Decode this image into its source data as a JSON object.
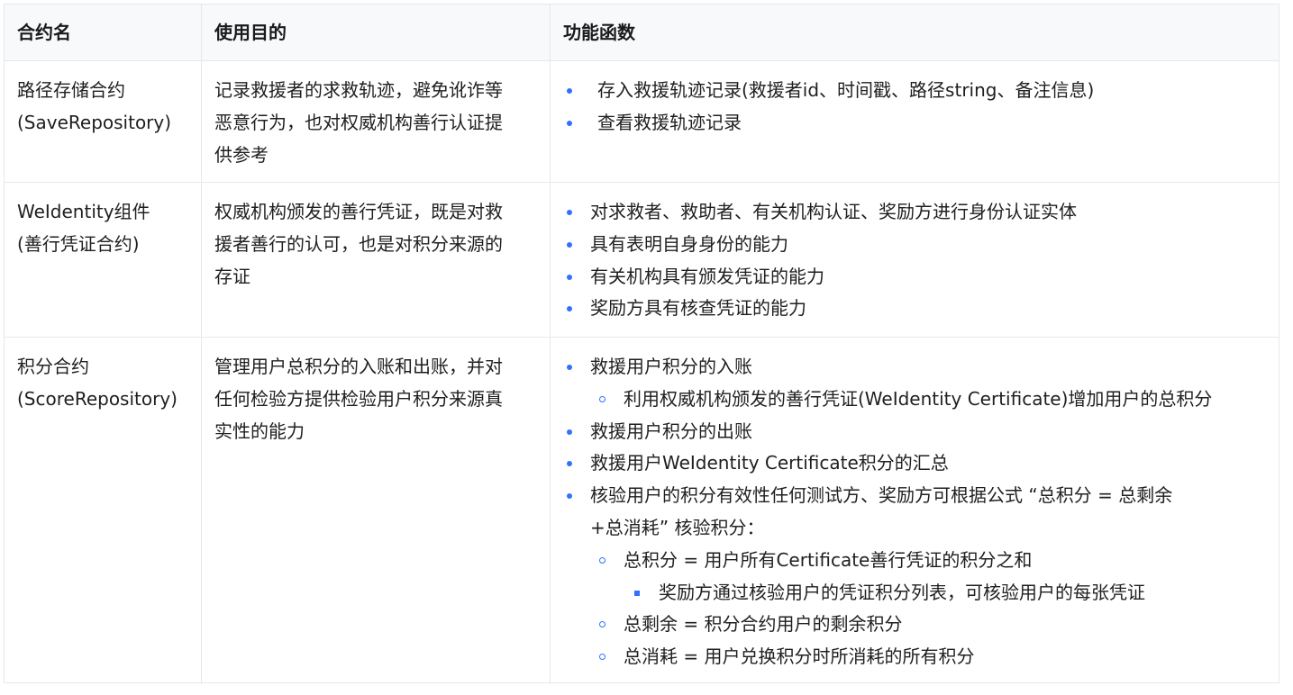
{
  "table": {
    "headers": [
      "合约名",
      "使用目的",
      "功能函数"
    ],
    "rows": [
      {
        "name_lines": [
          "路径存储合约",
          "(SaveRepository)"
        ],
        "purpose_lines": [
          "记录救援者的求救轨迹，避免讹诈等",
          "恶意行为，也对权威机构善行认证提",
          "供参考"
        ],
        "functions": [
          {
            "level": 1,
            "text": "存入救援轨迹记录(救援者id、时间戳、路径string、备注信息)"
          },
          {
            "level": 1,
            "text": "查看救援轨迹记录"
          }
        ]
      },
      {
        "name_lines": [
          "WeIdentity组件",
          "(善行凭证合约)"
        ],
        "purpose_lines": [
          "权威机构颁发的善行凭证，既是对救",
          "援者善行的认可，也是对积分来源的",
          "存证"
        ],
        "functions": [
          {
            "level": 1,
            "text": "对求救者、救助者、有关机构认证、奖励方进行身份认证实体"
          },
          {
            "level": 1,
            "text": "具有表明自身身份的能力"
          },
          {
            "level": 1,
            "text": "有关机构具有颁发凭证的能力"
          },
          {
            "level": 1,
            "text": "奖励方具有核查凭证的能力"
          }
        ]
      },
      {
        "name_lines": [
          "积分合约",
          "(ScoreRepository)"
        ],
        "purpose_lines": [
          "管理用户总积分的入账和出账，并对",
          "任何检验方提供检验用户积分来源真",
          "实性的能力"
        ],
        "functions": [
          {
            "level": 1,
            "text": "救援用户积分的入账"
          },
          {
            "level": 2,
            "text": "利用权威机构颁发的善行凭证(WeIdentity Certificate)增加用户的总积分"
          },
          {
            "level": 1,
            "text": "救援用户积分的出账"
          },
          {
            "level": 1,
            "text": "救援用户WeIdentity Certificate积分的汇总"
          },
          {
            "level": 1,
            "text": "核验用户的积分有效性任何测试方、奖励方可根据公式 “总积分 = 总剩余"
          },
          {
            "level": 0,
            "text": "+总消耗” 核验积分："
          },
          {
            "level": 2,
            "text": "总积分 = 用户所有Certificate善行凭证的积分之和"
          },
          {
            "level": 3,
            "text": "奖励方通过核验用户的凭证积分列表，可核验用户的每张凭证"
          },
          {
            "level": 2,
            "text": "总剩余 = 积分合约用户的剩余积分"
          },
          {
            "level": 2,
            "text": "总消耗 = 用户兑换积分时所消耗的所有积分"
          }
        ]
      }
    ]
  },
  "colors": {
    "bullet": "#3370ff",
    "border": "#e6e8eb",
    "header_bg": "#f8f9fa"
  }
}
